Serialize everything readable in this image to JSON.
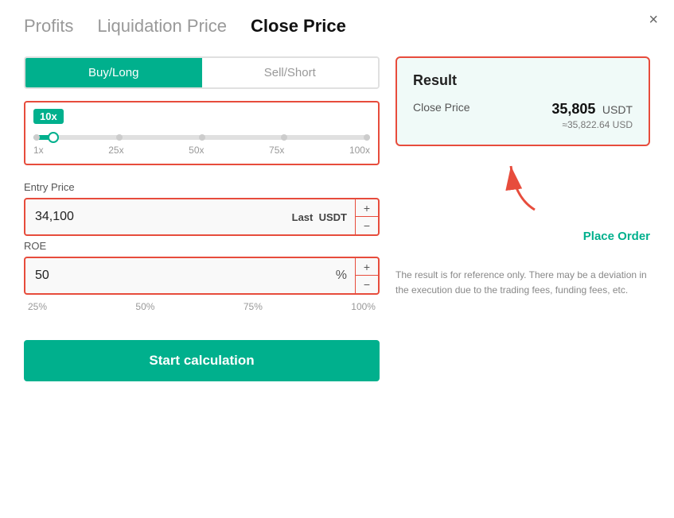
{
  "modal": {
    "close_label": "×"
  },
  "tabs": [
    {
      "id": "profits",
      "label": "Profits",
      "active": false
    },
    {
      "id": "liquidation",
      "label": "Liquidation Price",
      "active": false
    },
    {
      "id": "close-price",
      "label": "Close Price",
      "active": true
    }
  ],
  "direction": {
    "buy_label": "Buy/Long",
    "sell_label": "Sell/Short"
  },
  "leverage": {
    "badge": "10x",
    "labels": [
      "1x",
      "25x",
      "50x",
      "75x",
      "100x"
    ]
  },
  "entry_price": {
    "label": "Entry Price",
    "value": "34,100",
    "suffix_last": "Last",
    "suffix_unit": "USDT",
    "plus": "+",
    "minus": "−"
  },
  "roe": {
    "label": "ROE",
    "value": "50",
    "unit": "%",
    "presets": [
      "25%",
      "50%",
      "75%",
      "100%"
    ],
    "plus": "+",
    "minus": "−"
  },
  "start_btn": {
    "label": "Start calculation"
  },
  "result": {
    "title": "Result",
    "close_price_label": "Close Price",
    "close_price_value": "35,805",
    "close_price_unit": "USDT",
    "close_price_usd": "≈35,822.64 USD",
    "place_order_label": "Place Order",
    "disclaimer": "The result is for reference only. There may be a deviation in the execution due to the trading fees, funding fees, etc."
  }
}
